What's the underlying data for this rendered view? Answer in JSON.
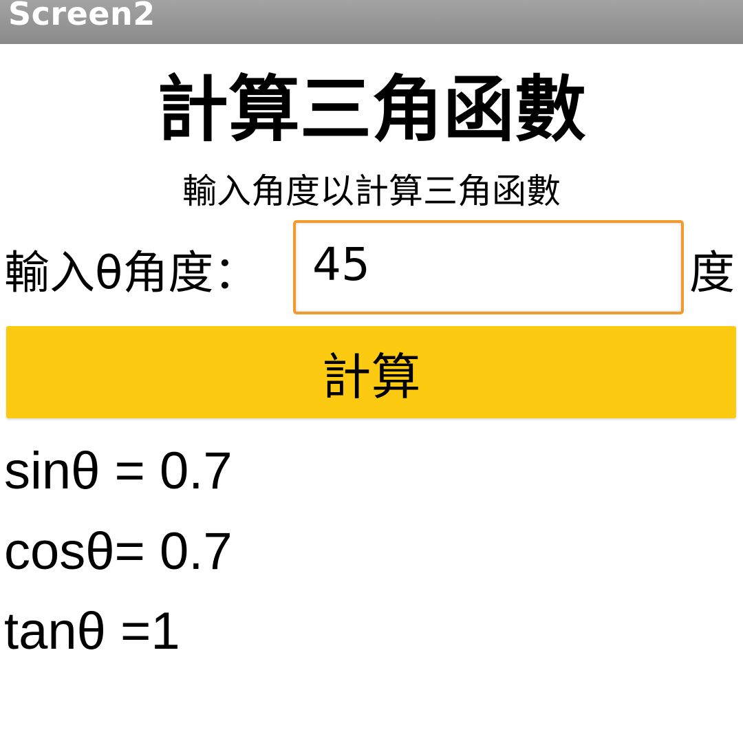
{
  "window": {
    "title": "Screen2"
  },
  "main": {
    "heading": "計算三角函數",
    "subtitle": "輸入角度以計算三角函數",
    "angle_label": "輸入θ角度：",
    "angle_value": "45",
    "unit_label": "度",
    "calculate_label": "計算"
  },
  "results": {
    "sin": "sinθ = 0.7",
    "cos": "cosθ= 0.7",
    "tan": "tanθ =1"
  },
  "colors": {
    "title_bar": "#8f8f8f",
    "input_border": "#f39a2d",
    "button_background": "#fdca12"
  }
}
